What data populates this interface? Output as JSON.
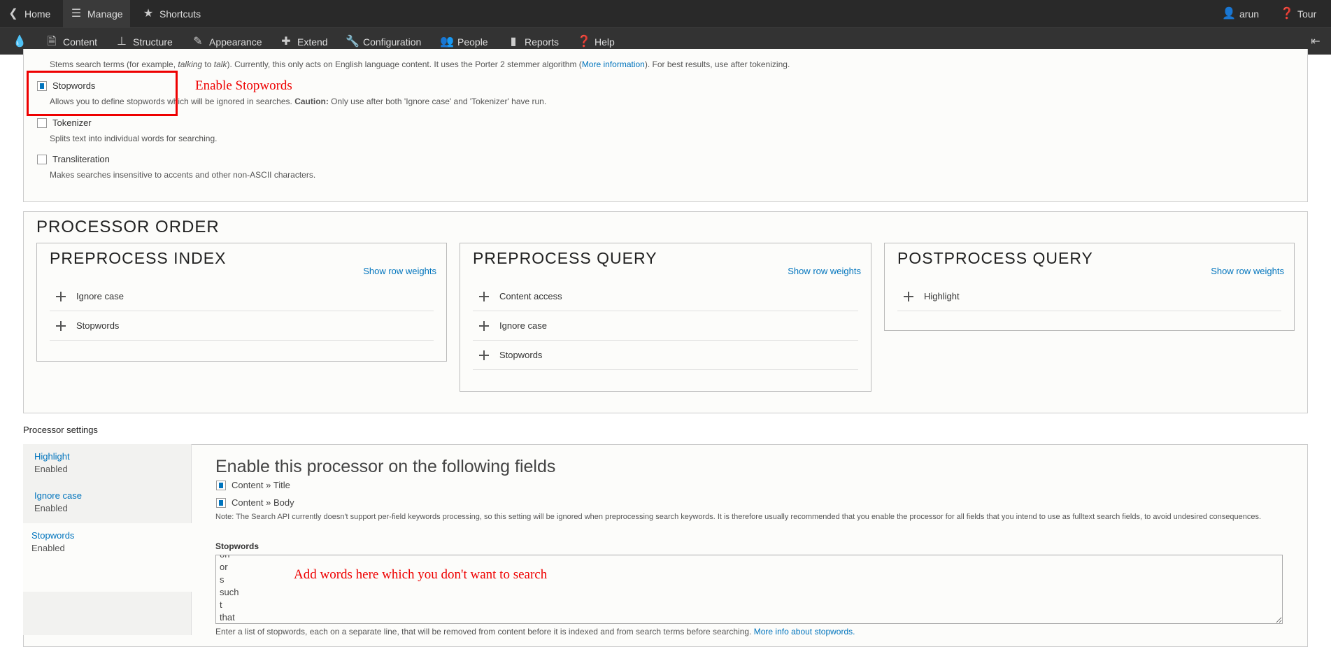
{
  "toolbar": {
    "home": "Home",
    "manage": "Manage",
    "shortcuts": "Shortcuts",
    "user": "arun",
    "tour": "Tour"
  },
  "menu": {
    "items": [
      "Content",
      "Structure",
      "Appearance",
      "Extend",
      "Configuration",
      "People",
      "Reports",
      "Help"
    ]
  },
  "processors": {
    "stemmer_desc_a": "Stems search terms (for example, ",
    "stemmer_em1": "talking",
    "stemmer_to": " to ",
    "stemmer_em2": "talk",
    "stemmer_desc_b": "). Currently, this only acts on English language content. It uses the Porter 2 stemmer algorithm (",
    "stemmer_link": "More information",
    "stemmer_desc_c": "). For best results, use after tokenizing.",
    "items": [
      {
        "label": "Stopwords",
        "checked": true,
        "desc_a": "Allows you to define stopwords which will be ignored in searches. ",
        "desc_bold": "Caution:",
        "desc_b": " Only use after both 'Ignore case' and 'Tokenizer' have run."
      },
      {
        "label": "Tokenizer",
        "checked": false,
        "desc": "Splits text into individual words for searching."
      },
      {
        "label": "Transliteration",
        "checked": false,
        "desc": "Makes searches insensitive to accents and other non-ASCII characters."
      }
    ]
  },
  "annotations": {
    "enable": "Enable Stopwords",
    "add": "Add words here which you don't want to search"
  },
  "processor_order": {
    "title": "Processor order",
    "show_row_weights": "Show row weights",
    "groups": [
      {
        "title": "Preprocess index",
        "rows": [
          "Ignore case",
          "Stopwords"
        ]
      },
      {
        "title": "Preprocess query",
        "rows": [
          "Content access",
          "Ignore case",
          "Stopwords"
        ]
      },
      {
        "title": "Postprocess query",
        "rows": [
          "Highlight"
        ]
      }
    ]
  },
  "settings": {
    "title": "Processor settings",
    "tabs": [
      {
        "label": "Highlight",
        "status": "Enabled"
      },
      {
        "label": "Ignore case",
        "status": "Enabled"
      },
      {
        "label": "Stopwords",
        "status": "Enabled",
        "selected": true
      }
    ],
    "heading": "Enable this processor on the following fields",
    "fields": [
      {
        "label": "Content » Title",
        "checked": true
      },
      {
        "label": "Content » Body",
        "checked": true
      }
    ],
    "note": "Note: The Search API currently doesn't support per-field keywords processing, so this setting will be ignored when preprocessing search keywords. It is therefore usually recommended that you enable the processor for all fields that you intend to use as fulltext search fields, to avoid undesired consequences.",
    "stopwords_label": "Stopwords",
    "stopwords_value": "on\nor\ns\nsuch\nt\nthat",
    "stopwords_help": "Enter a list of stopwords, each on a separate line, that will be removed from content before it is indexed and from search terms before searching. ",
    "stopwords_link": "More info about stopwords.",
    "stopwords_link_suffix": "."
  },
  "colors": {
    "link": "#0074bd",
    "toolbar": "#292929",
    "annotation": "#e00000"
  }
}
